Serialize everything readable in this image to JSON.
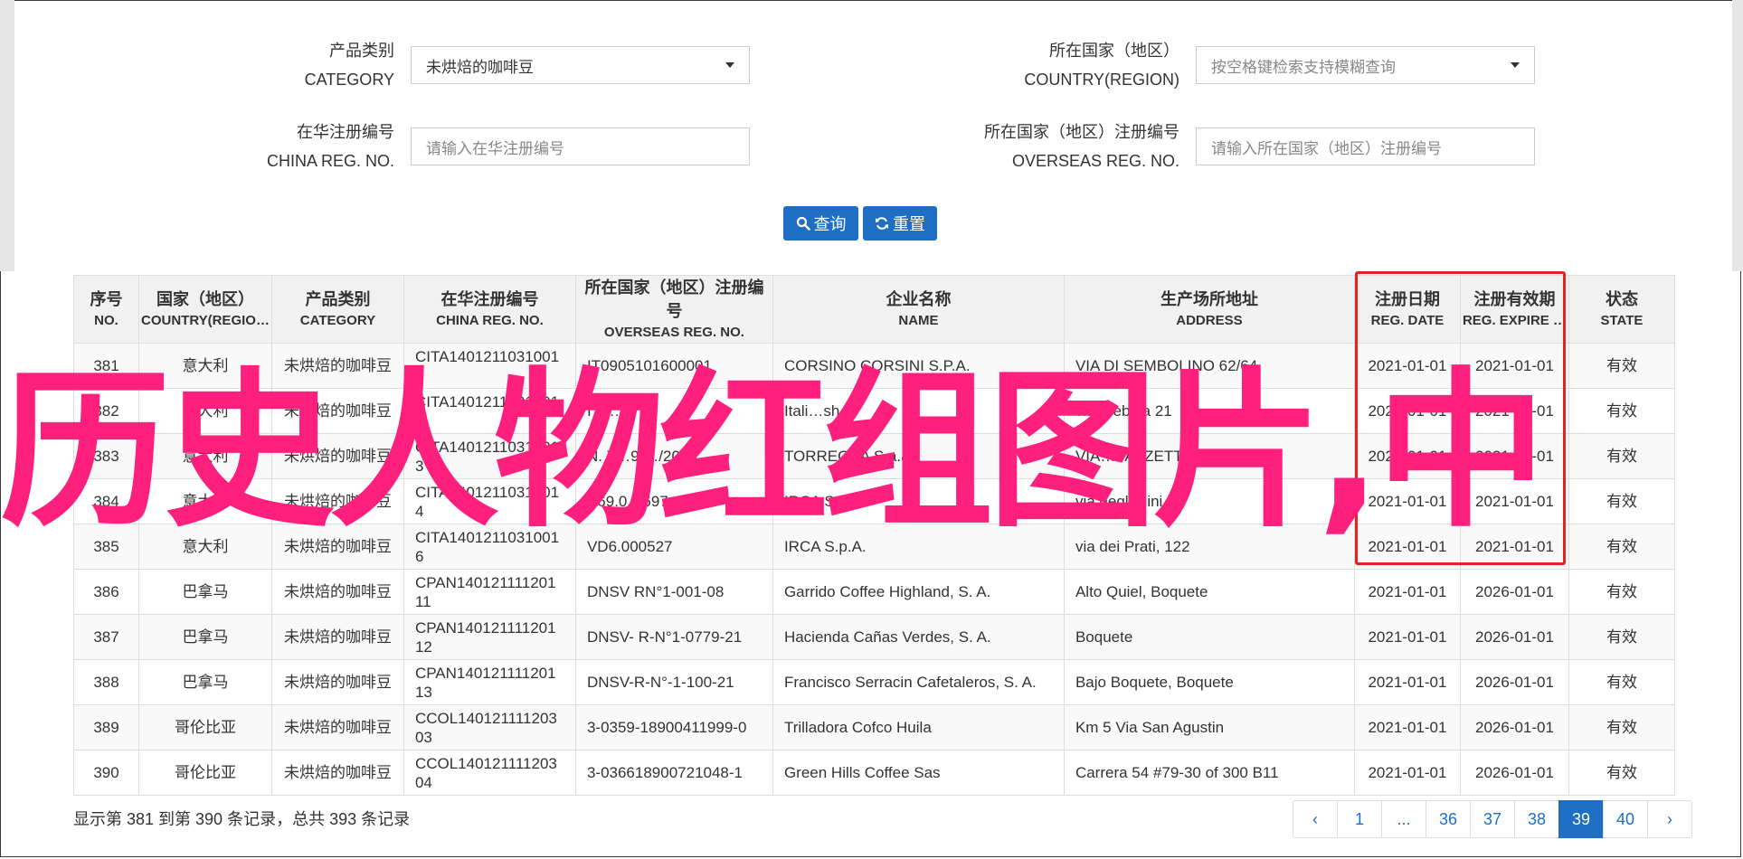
{
  "filters": {
    "category": {
      "label_cn": "产品类别",
      "label_en": "CATEGORY",
      "value": "未烘焙的咖啡豆"
    },
    "country": {
      "label_cn": "所在国家（地区）",
      "label_en": "COUNTRY(REGION)",
      "placeholder": "按空格键检索支持模糊查询"
    },
    "china_reg": {
      "label_cn": "在华注册编号",
      "label_en": "CHINA REG. NO.",
      "placeholder": "请输入在华注册编号"
    },
    "overseas_reg": {
      "label_cn": "所在国家（地区）注册编号",
      "label_en": "OVERSEAS REG. NO.",
      "placeholder": "请输入所在国家（地区）注册编号"
    }
  },
  "buttons": {
    "search": "查询",
    "reset": "重置"
  },
  "table": {
    "columns": [
      {
        "cn": "序号",
        "en": "NO."
      },
      {
        "cn": "国家（地区）",
        "en": "COUNTRY(REGIO…"
      },
      {
        "cn": "产品类别",
        "en": "CATEGORY"
      },
      {
        "cn": "在华注册编号",
        "en": "CHINA REG. NO."
      },
      {
        "cn": "所在国家（地区）注册编号",
        "en": "OVERSEAS REG. NO."
      },
      {
        "cn": "企业名称",
        "en": "NAME"
      },
      {
        "cn": "生产场所地址",
        "en": "ADDRESS"
      },
      {
        "cn": "注册日期",
        "en": "REG. DATE"
      },
      {
        "cn": "注册有效期",
        "en": "REG. EXPIRE …"
      },
      {
        "cn": "状态",
        "en": "STATE"
      }
    ],
    "rows": [
      [
        "381",
        "意大利",
        "未烘焙的咖啡豆",
        "CITA1401211031001 1",
        "IT0905101600001",
        "CORSINO CORSINI S.P.A.",
        "VIA DI SEMBOLINO 62/64",
        "2021-01-01",
        "2021-01-01",
        "有效"
      ],
      [
        "382",
        "意大利",
        "未烘焙的咖啡豆",
        "CITA1401211031001 2",
        "IT2…8",
        "Itali…sh",
        "via Trebbia 21",
        "2021-01-01",
        "2021-01-01",
        "有效"
      ],
      [
        "383",
        "意大利",
        "未烘焙的咖啡豆",
        "CITA1401211031001 3",
        "N. 7…9/…/2003",
        "TORREOKA S.a.a.",
        "VIA…VAZZETTI",
        "2021-01-01",
        "2021-01-01",
        "有效"
      ],
      [
        "384",
        "意大利",
        "未烘焙的咖啡豆",
        "CITA1401211031001 4",
        "V69.0…697",
        "IRCA S.p.A.",
        "via degli…ini,",
        "2021-01-01",
        "2021-01-01",
        "有效"
      ],
      [
        "385",
        "意大利",
        "未烘焙的咖啡豆",
        "CITA1401211031001 6",
        "VD6.000527",
        "IRCA S.p.A.",
        "via dei Prati, 122",
        "2021-01-01",
        "2021-01-01",
        "有效"
      ],
      [
        "386",
        "巴拿马",
        "未烘焙的咖啡豆",
        "CPAN140121111201 11",
        "DNSV RN°1-001-08",
        "Garrido Coffee Highland, S. A.",
        "Alto Quiel, Boquete",
        "2021-01-01",
        "2026-01-01",
        "有效"
      ],
      [
        "387",
        "巴拿马",
        "未烘焙的咖啡豆",
        "CPAN140121111201 12",
        "DNSV- R-N°1-0779-21",
        "Hacienda Cañas Verdes, S. A.",
        "Boquete",
        "2021-01-01",
        "2026-01-01",
        "有效"
      ],
      [
        "388",
        "巴拿马",
        "未烘焙的咖啡豆",
        "CPAN140121111201 13",
        "DNSV-R-N°-1-100-21",
        "Francisco Serracin Cafetaleros, S. A.",
        "Bajo Boquete, Boquete",
        "2021-01-01",
        "2026-01-01",
        "有效"
      ],
      [
        "389",
        "哥伦比亚",
        "未烘焙的咖啡豆",
        "CCOL140121111203 03",
        "3-0359-18900411999-0",
        "Trilladora Cofco Huila",
        "Km 5 Via San Agustin",
        "2021-01-01",
        "2026-01-01",
        "有效"
      ],
      [
        "390",
        "哥伦比亚",
        "未烘焙的咖啡豆",
        "CCOL140121111203 04",
        "3-036618900721048-1",
        "Green Hills Coffee Sas",
        "Carrera 54 #79-30 of 300 B11",
        "2021-01-01",
        "2026-01-01",
        "有效"
      ]
    ]
  },
  "overlay_text": "历史人物红组图片,中",
  "footer": {
    "info": "显示第 381 到第 390 条记录，总共 393 条记录"
  },
  "pagination": {
    "prev": "‹",
    "pages": [
      "1",
      "...",
      "36",
      "37",
      "38",
      "39",
      "40"
    ],
    "active": "39",
    "next": "›"
  },
  "colors": {
    "accent": "#1e6fc3",
    "highlight_box": "#e0241f",
    "overlay": "#ff1f7d"
  }
}
